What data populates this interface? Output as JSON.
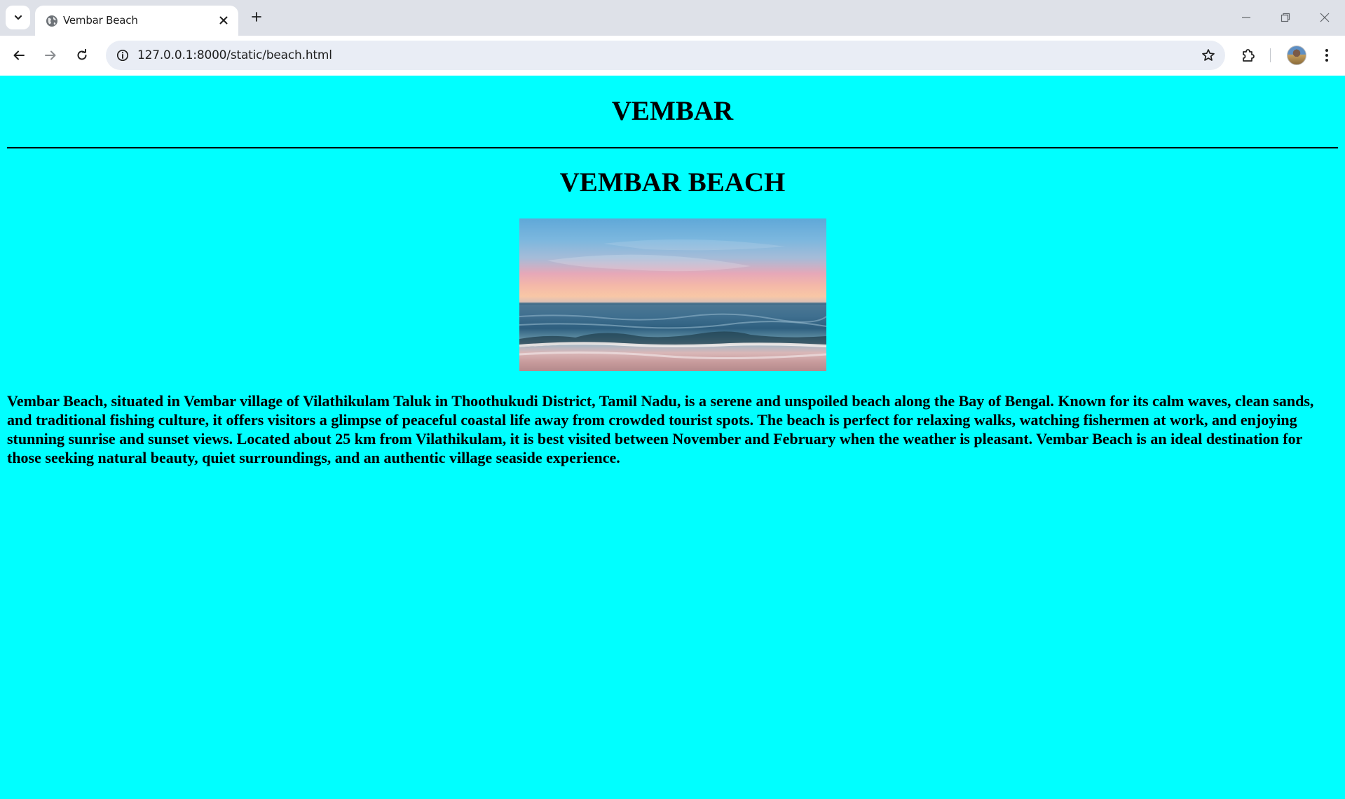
{
  "browser": {
    "tab_title": "Vembar Beach",
    "url": "127.0.0.1:8000/static/beach.html",
    "icons": {
      "tab_search": "chevron-down-icon",
      "favicon": "globe-icon",
      "tab_close": "close-icon",
      "new_tab": "plus-icon",
      "back": "arrow-left-icon",
      "forward": "arrow-right-icon",
      "reload": "reload-icon",
      "site_info": "info-icon",
      "bookmark": "star-icon",
      "extensions": "puzzle-icon",
      "menu": "kebab-menu-icon",
      "minimize": "minimize-icon",
      "restore": "restore-icon",
      "close_window": "close-icon"
    }
  },
  "page": {
    "background_color": "#00ffff",
    "site_heading": "VEMBAR",
    "beach_heading": "VEMBAR BEACH",
    "description": "Vembar Beach, situated in Vembar village of Vilathikulam Taluk in Thoothukudi District, Tamil Nadu, is a serene and unspoiled beach along the Bay of Bengal. Known for its calm waves, clean sands, and traditional fishing culture, it offers visitors a glimpse of peaceful coastal life away from crowded tourist spots. The beach is perfect for relaxing walks, watching fishermen at work, and enjoying stunning sunrise and sunset views. Located about 25 km from Vilathikulam, it is best visited between November and February when the weather is pleasant. Vembar Beach is an ideal destination for those seeking natural beauty, quiet surroundings, and an authentic village seaside experience."
  }
}
